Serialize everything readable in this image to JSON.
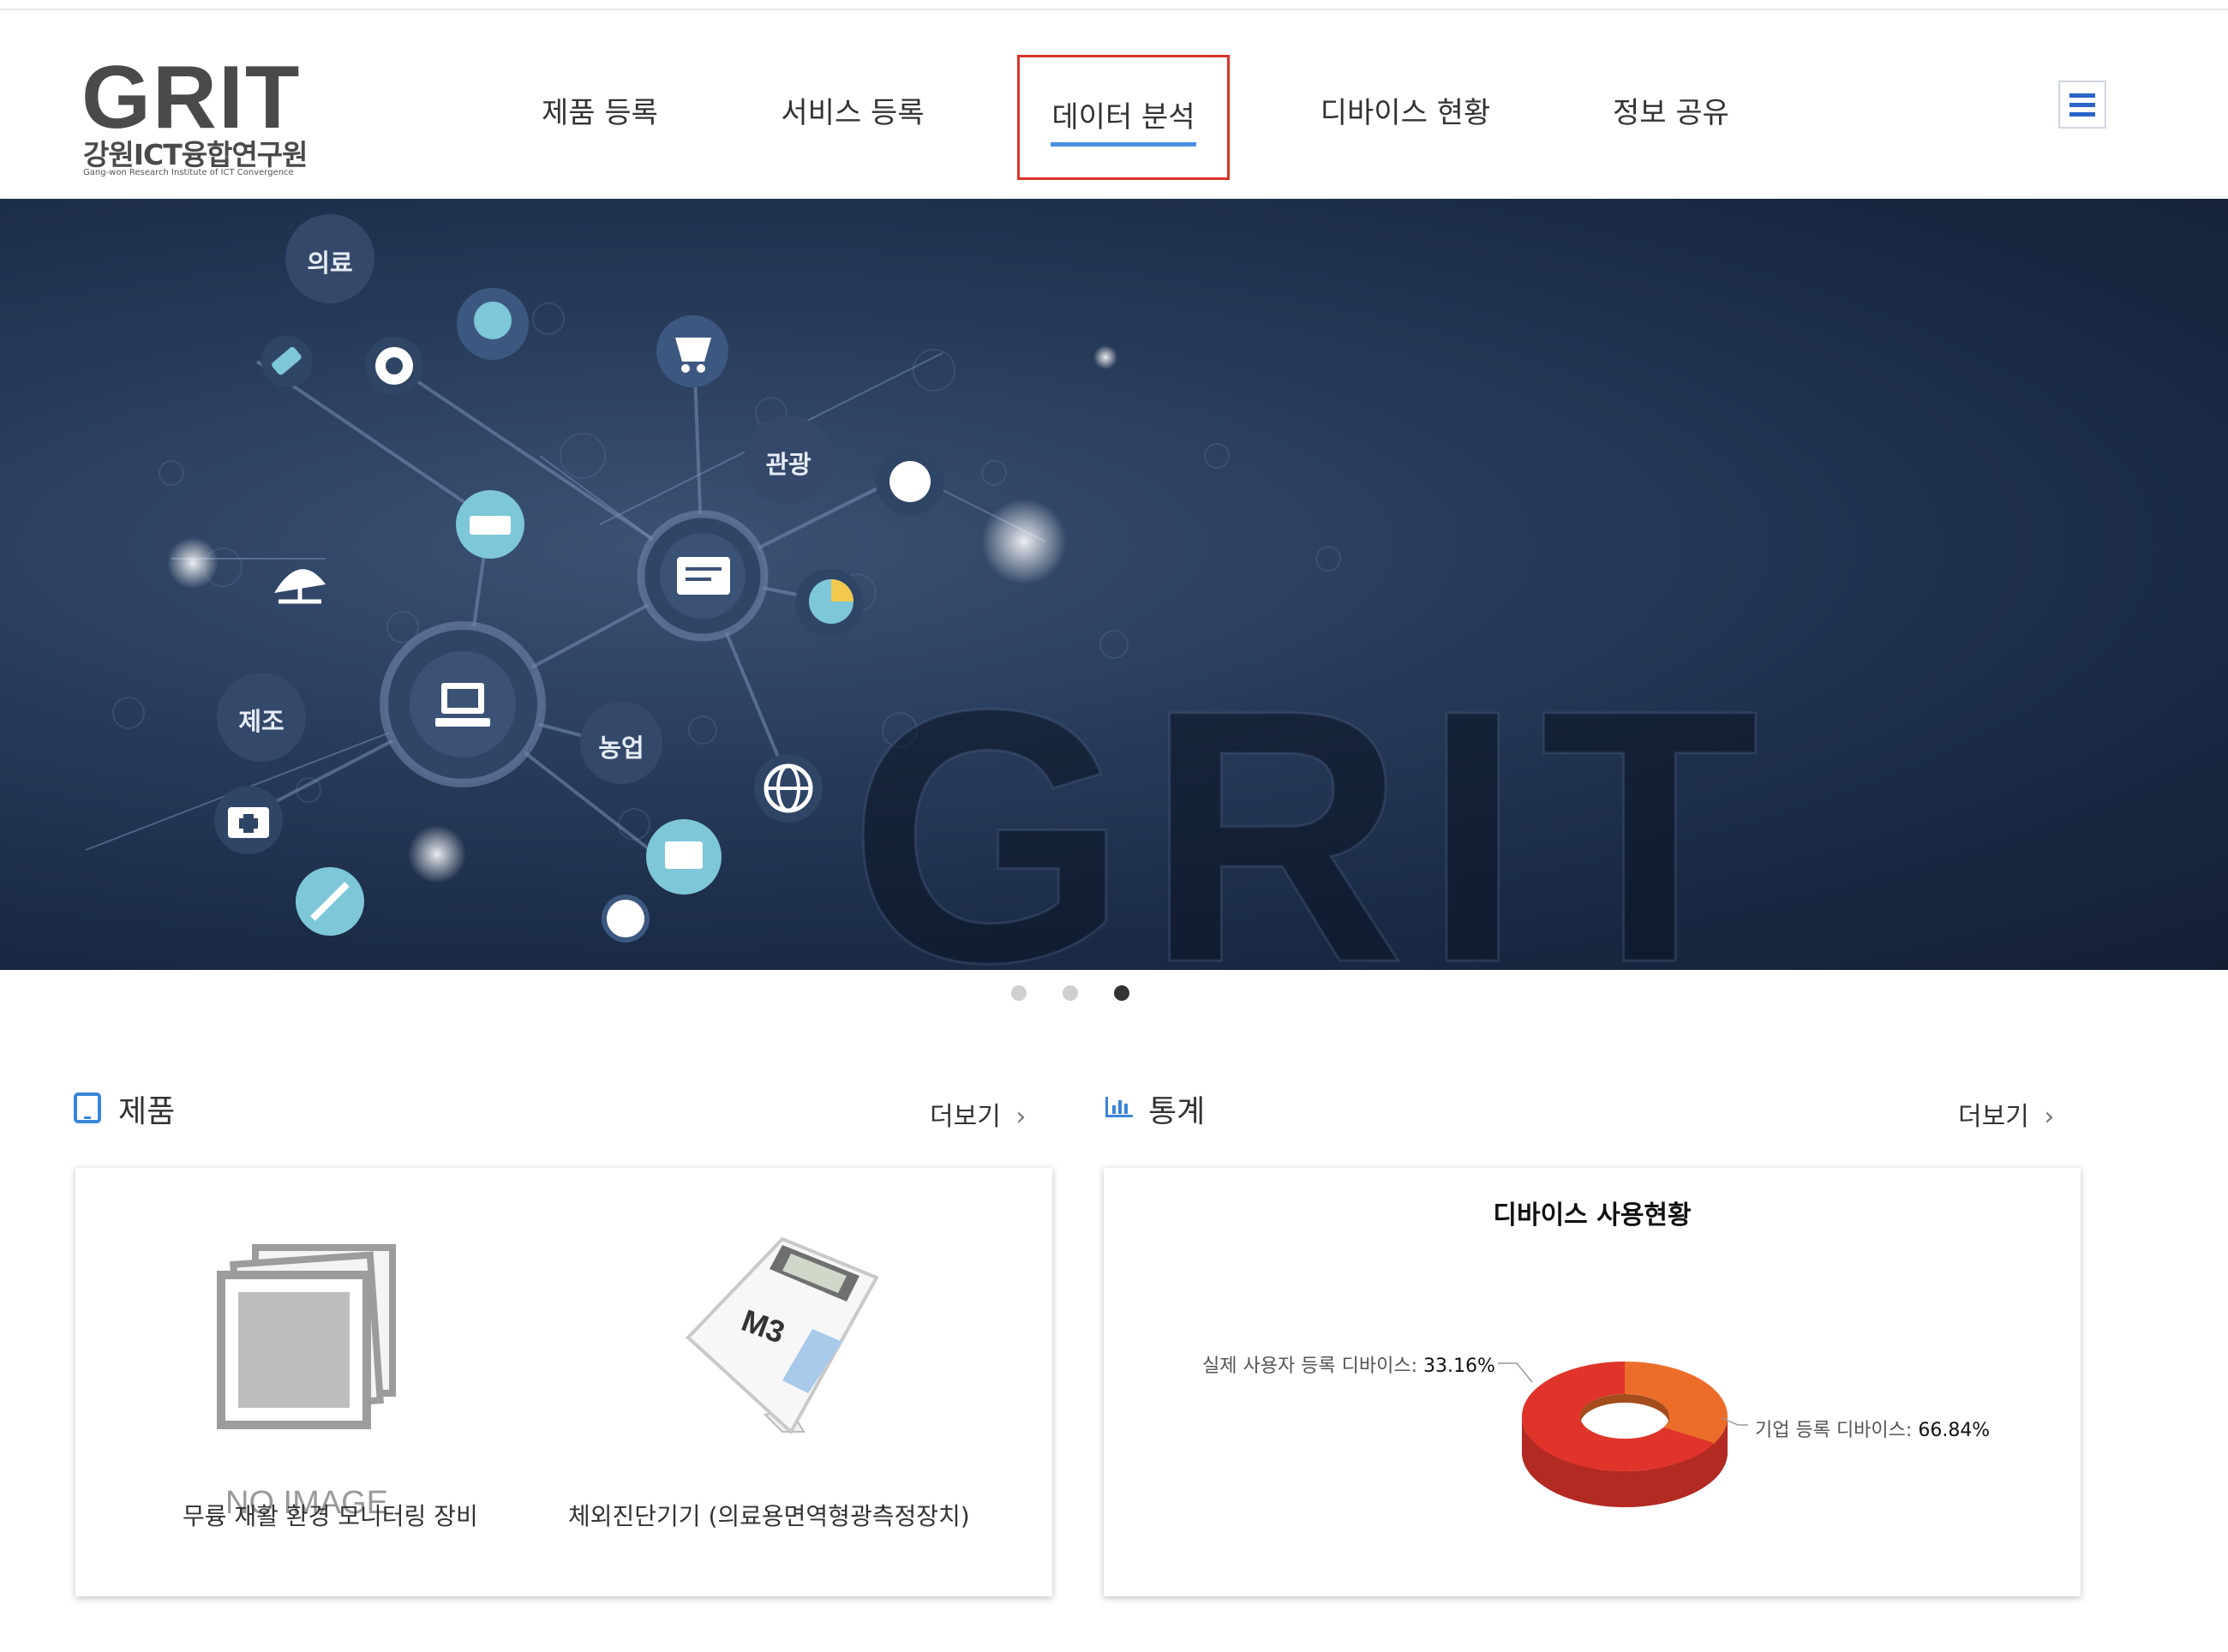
{
  "header": {
    "logo_main": "GRIT",
    "logo_sub": "강원ICT융합연구원",
    "logo_en": "Gang-won Research Institute of ICT Convergence",
    "nav": [
      {
        "label": "제품 등록"
      },
      {
        "label": "서비스 등록"
      },
      {
        "label": "데이터 분석",
        "active": true
      },
      {
        "label": "디바이스 현황"
      },
      {
        "label": "정보 공유"
      }
    ],
    "menu_icon": "hamburger-icon",
    "accent_color": "#2a64c6",
    "highlight_color": "#d9342b"
  },
  "hero": {
    "watermark": "GRIT",
    "nodes": [
      "의료",
      "관광",
      "제조",
      "농업"
    ],
    "slides": 3,
    "active_slide": 3
  },
  "products": {
    "title": "제품",
    "more": "더보기",
    "items": [
      {
        "name": "무륭 재활 환경 모니터링 장비",
        "image_text": "NO IMAGE"
      },
      {
        "name": "체외진단기기 (의료용면역형광측정장치)",
        "image_text": "M3"
      }
    ]
  },
  "stats": {
    "title": "통계",
    "more": "더보기"
  },
  "chart_data": {
    "type": "pie",
    "title": "디바이스 사용현황",
    "categories": [
      "실제 사용자 등록 디바이스",
      "기업 등록 디바이스"
    ],
    "values": [
      33.16,
      66.84
    ],
    "value_labels": [
      "33.16%",
      "66.84%"
    ],
    "colors": [
      "#ec6d2a",
      "#e0342a"
    ],
    "donut": true
  }
}
